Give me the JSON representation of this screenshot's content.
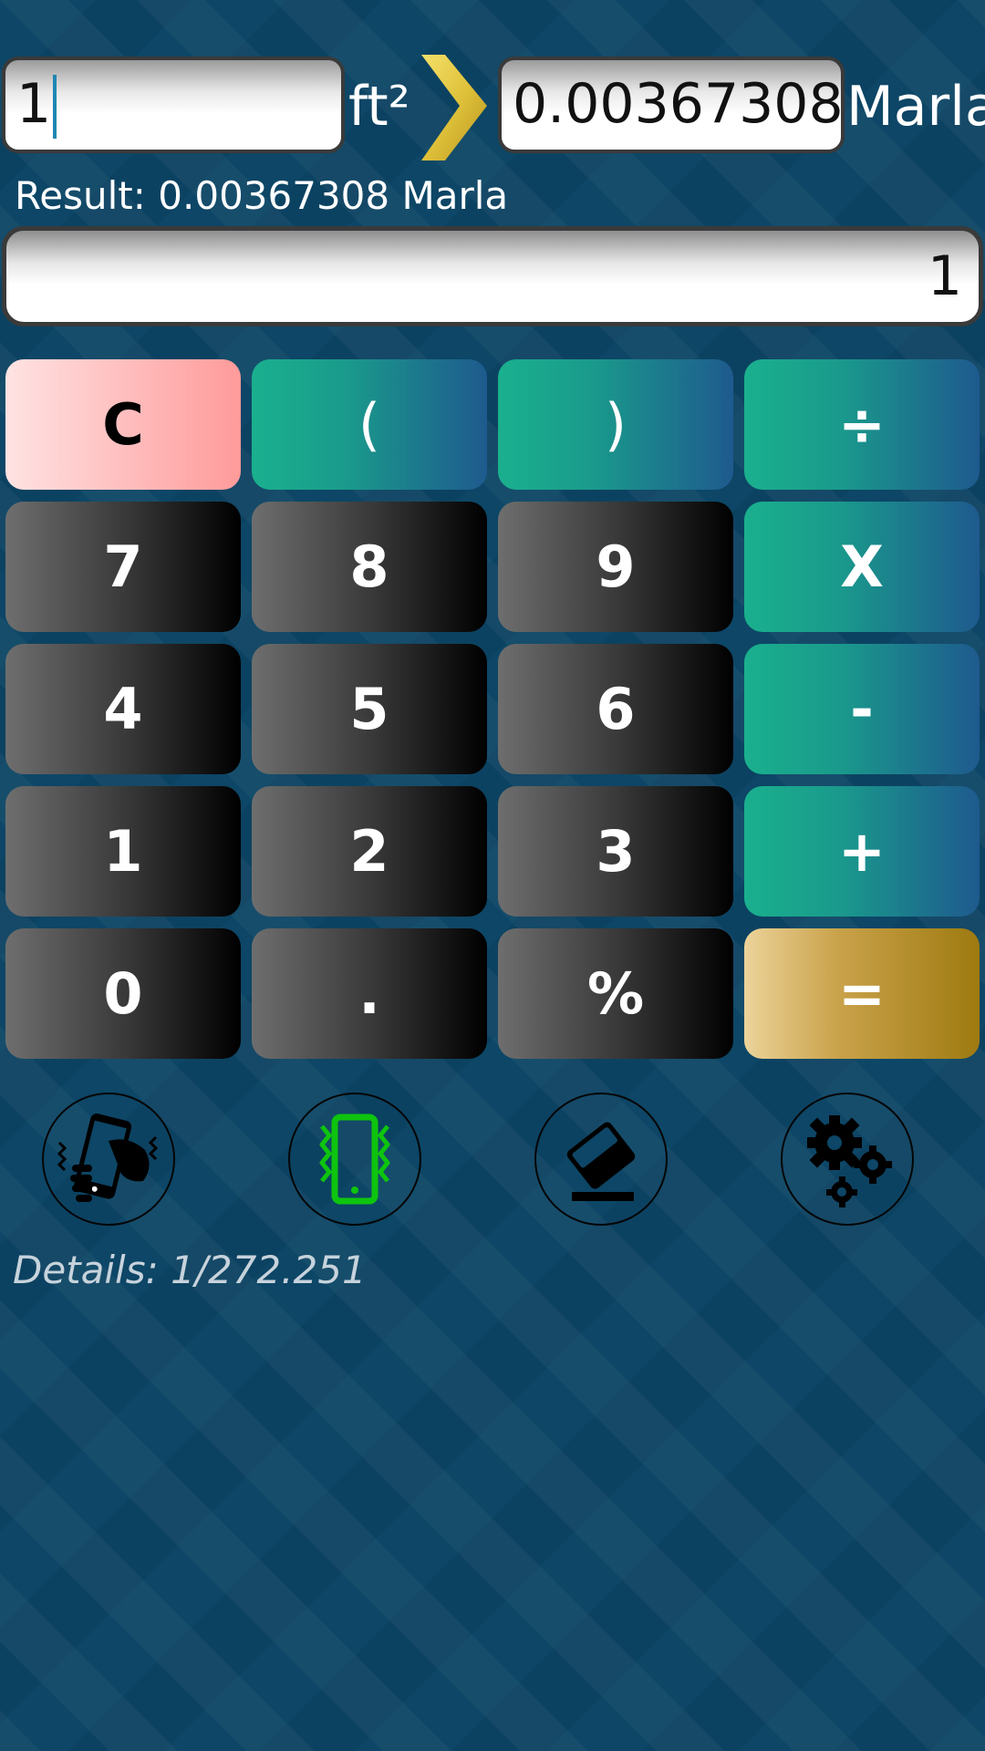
{
  "converter": {
    "input_value": "1",
    "from_unit": "ft²",
    "output_value": "0.00367308",
    "to_unit": "Marla",
    "arrow_icon": "chevron-right-icon",
    "arrow_color": "#e6cc3c"
  },
  "result_text": "Result: 0.00367308 Marla",
  "display_value": "1",
  "keys": {
    "clear": "C",
    "open_paren": "(",
    "close_paren": ")",
    "divide": "÷",
    "seven": "7",
    "eight": "8",
    "nine": "9",
    "multiply": "X",
    "four": "4",
    "five": "5",
    "six": "6",
    "minus": "-",
    "one": "1",
    "two": "2",
    "three": "3",
    "plus": "+",
    "zero": "0",
    "dot": ".",
    "percent": "%",
    "equals": "="
  },
  "tools": [
    {
      "icon": "shake-phone-icon",
      "color": "#000000"
    },
    {
      "icon": "vibrate-phone-icon",
      "color": "#0ec40e"
    },
    {
      "icon": "eraser-icon",
      "color": "#000000"
    },
    {
      "icon": "gears-icon",
      "color": "#000000"
    }
  ],
  "details_text": "Details: 1/272.251"
}
